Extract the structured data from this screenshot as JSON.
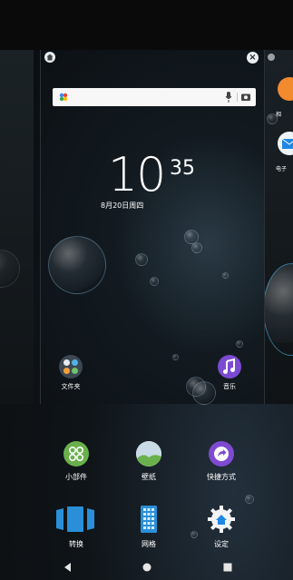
{
  "search": {
    "placeholder": ""
  },
  "clock": {
    "hour": "10",
    "minute": "35",
    "date": "8月20日周四"
  },
  "home_apps": [
    {
      "label": "文件夹"
    },
    {
      "label": "音乐"
    }
  ],
  "right_page_apps": [
    {
      "label": "相"
    },
    {
      "label": "电子"
    }
  ],
  "panel": {
    "row1": [
      {
        "label": "小部件",
        "icon": "widgets-icon"
      },
      {
        "label": "壁纸",
        "icon": "wallpaper-icon"
      },
      {
        "label": "快捷方式",
        "icon": "shortcut-icon"
      }
    ],
    "row2": [
      {
        "label": "转换",
        "icon": "transition-icon"
      },
      {
        "label": "网格",
        "icon": "grid-icon"
      },
      {
        "label": "设定",
        "icon": "settings-icon"
      }
    ]
  },
  "nav": {
    "back": "back-icon",
    "home": "home-icon",
    "recents": "recents-icon"
  },
  "colors": {
    "accent_music": "#7b4ad2",
    "accent_shortcut": "#7e4bd0",
    "accent_blue": "#1e88e5"
  }
}
